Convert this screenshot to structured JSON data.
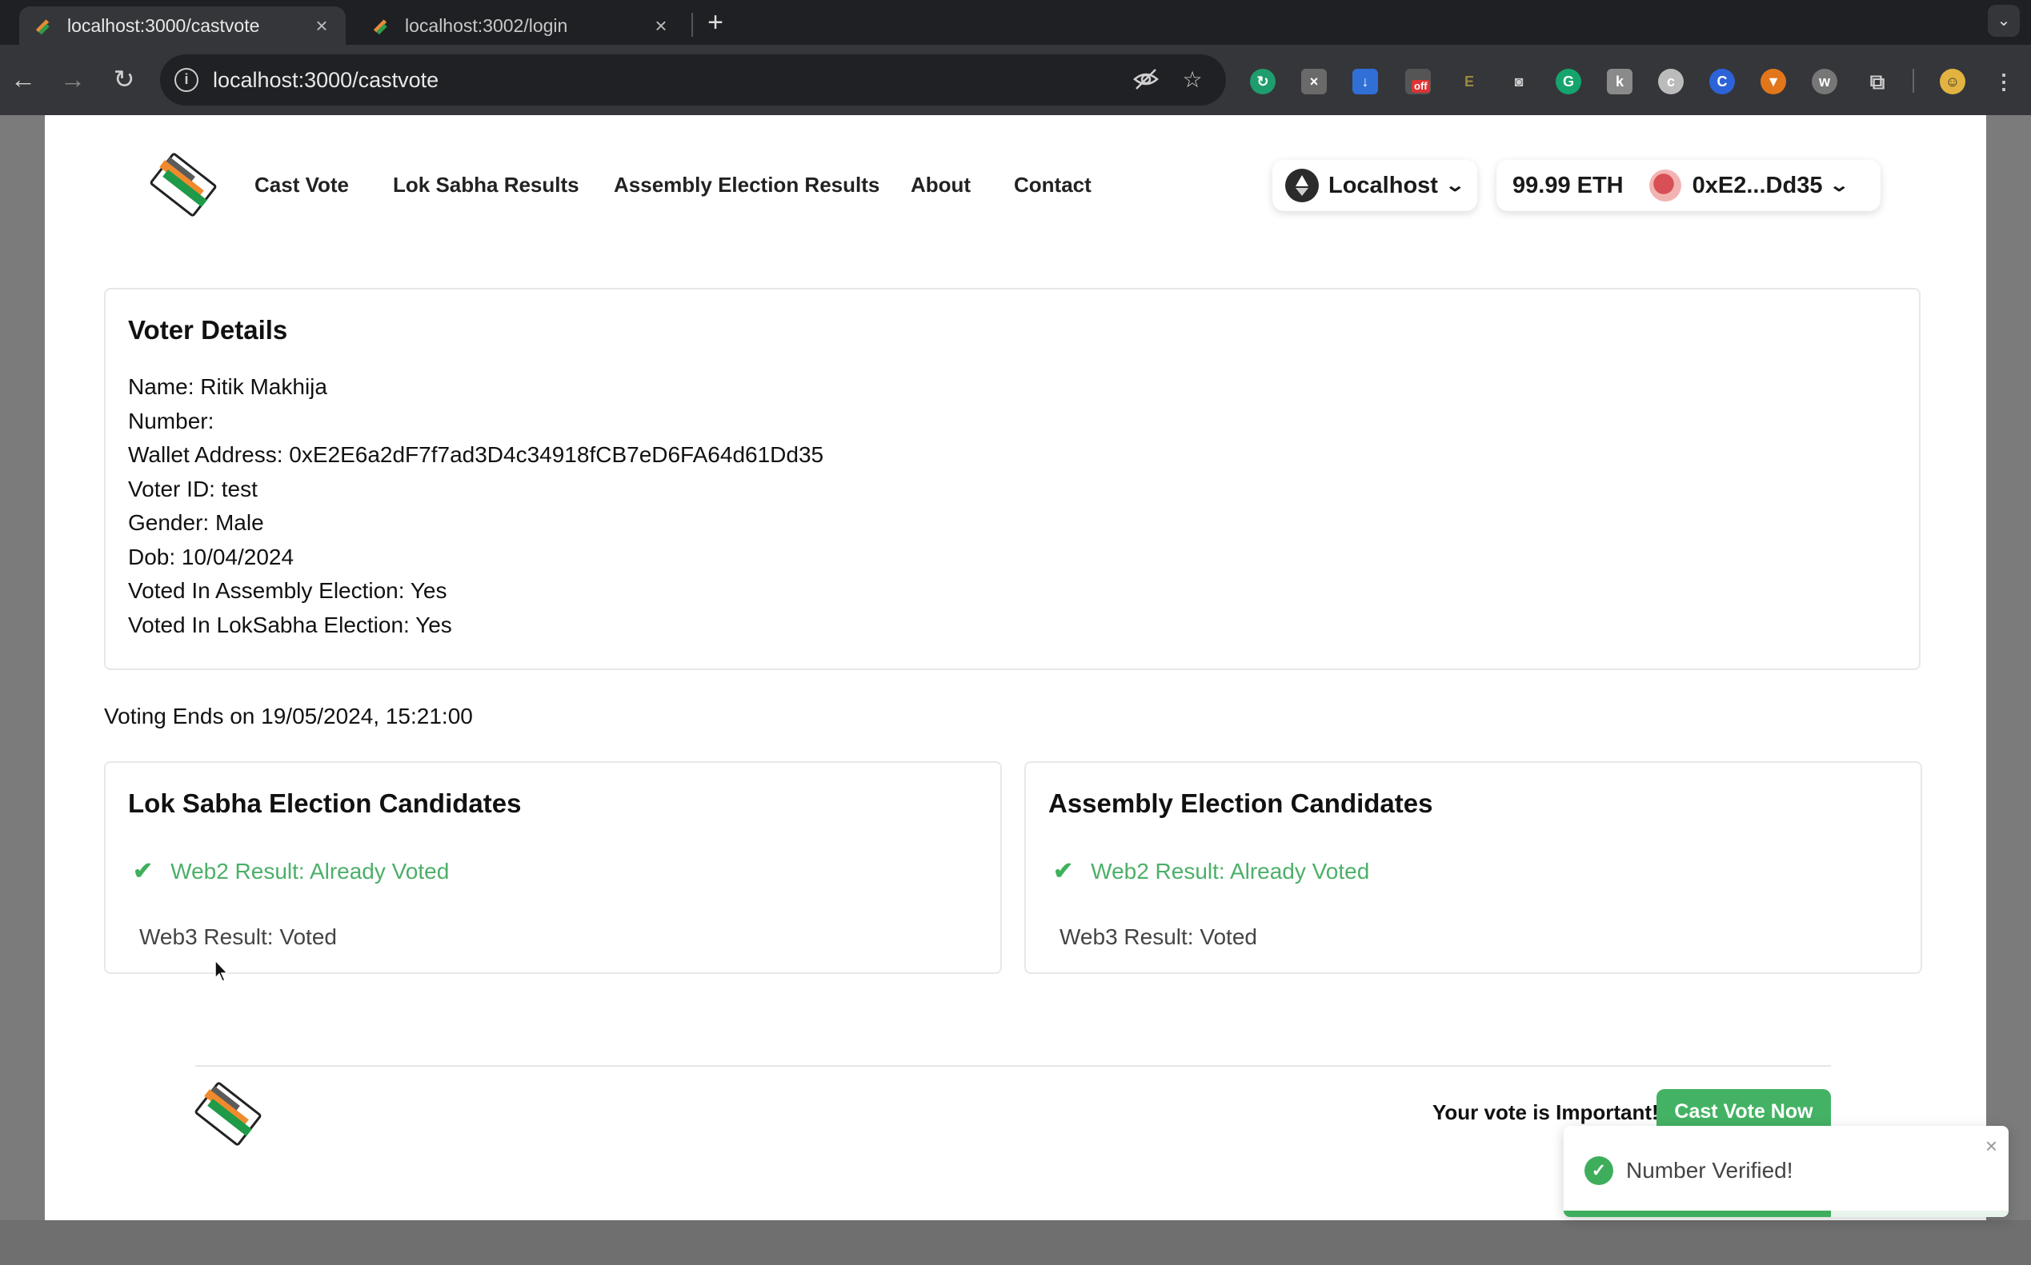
{
  "browser": {
    "tabs": [
      {
        "title": "localhost:3000/castvote",
        "close": "×"
      },
      {
        "title": "localhost:3002/login",
        "close": "×"
      }
    ],
    "new_tab": "+",
    "url": "localhost:3000/castvote"
  },
  "nav": {
    "links": [
      "Cast Vote",
      "Lok Sabha Results",
      "Assembly Election Results",
      "About",
      "Contact"
    ],
    "network": "Localhost",
    "balance": "99.99 ETH",
    "account": "0xE2...Dd35"
  },
  "voter": {
    "heading": "Voter Details",
    "lines": [
      "Name: Ritik Makhija",
      "Number:",
      "Wallet Address: 0xE2E6a2dF7f7ad3D4c34918fCB7eD6FA64d61Dd35",
      "Voter ID: test",
      "Gender: Male",
      "Dob: 10/04/2024",
      "Voted In Assembly Election: Yes",
      "Voted In LokSabha Election: Yes"
    ]
  },
  "voting_ends": "Voting Ends on 19/05/2024, 15:21:00",
  "candidates": [
    {
      "heading": "Lok Sabha Election Candidates",
      "web2": "Web2 Result: Already Voted",
      "web3": "Web3 Result: Voted"
    },
    {
      "heading": "Assembly Election Candidates",
      "web2": "Web2 Result: Already Voted",
      "web3": "Web3 Result: Voted"
    }
  ],
  "footer": {
    "note": "Your vote is Important!",
    "cta": "Cast Vote Now"
  },
  "toast": {
    "message": "Number Verified!",
    "close": "×",
    "progress": 0.6
  },
  "colors": {
    "accent_green": "#44b264",
    "chrome_dark": "#35363a"
  }
}
